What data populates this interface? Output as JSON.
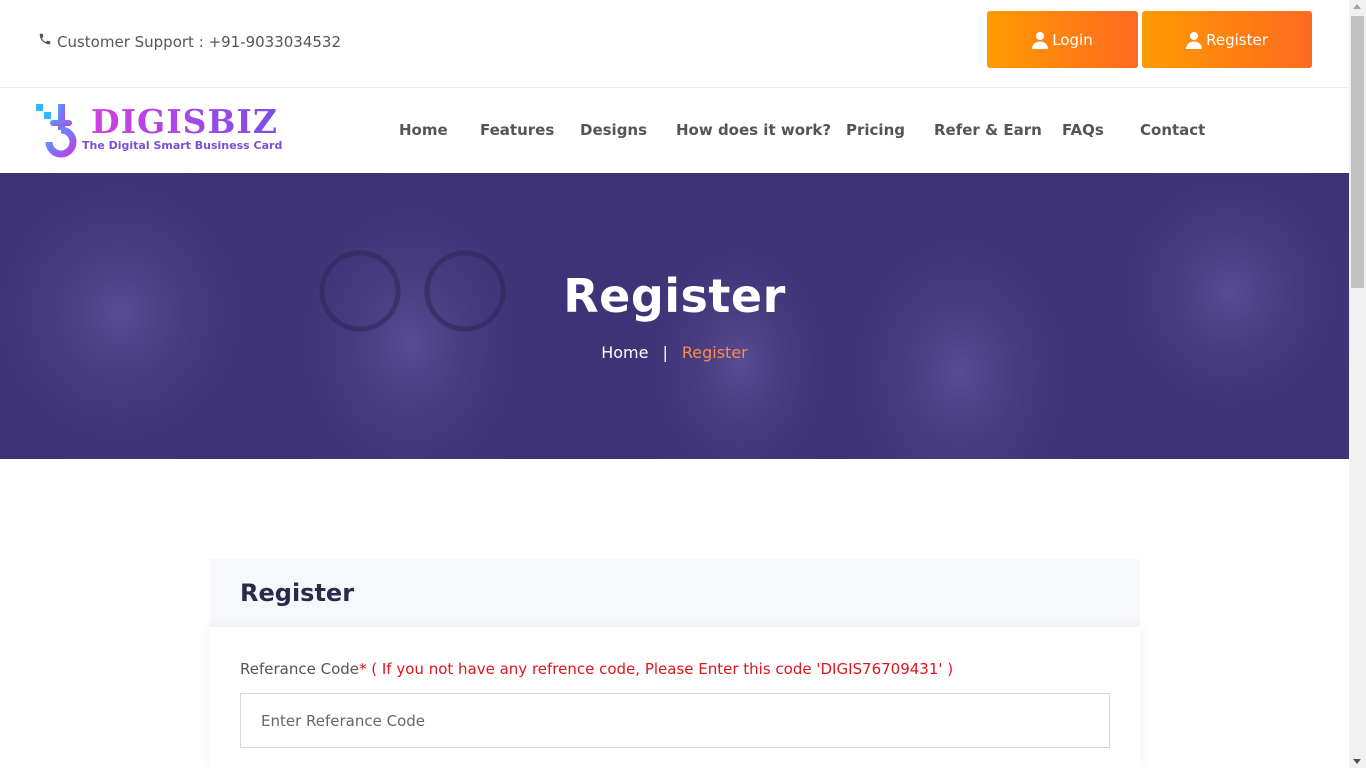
{
  "topbar": {
    "support_icon": "phone-icon",
    "support_text": "Customer Support : +91-9033034532",
    "login_label": "Login",
    "register_label": "Register",
    "button_icon": "user-icon",
    "accent_from": "#ff9a00",
    "accent_to": "#ff6a22"
  },
  "logo": {
    "name": "DIGISBIZ",
    "tagline": "The Digital Smart Business Card"
  },
  "nav": {
    "items": [
      "Home",
      "Features",
      "Designs",
      "How does it work?",
      "Pricing",
      "Refer & Earn",
      "FAQs",
      "Contact"
    ]
  },
  "hero": {
    "title": "Register",
    "breadcrumb": {
      "home": "Home",
      "separator": "|",
      "current": "Register"
    },
    "overlay_color": "#3e3376"
  },
  "form": {
    "card_title": "Register",
    "referral_label": "Referance Code",
    "required_mark": "*",
    "referral_hint": " ( If you not have any refrence code, Please Enter this code 'DIGIS76709431' )",
    "referral_placeholder": "Enter Referance Code",
    "referral_value": ""
  }
}
